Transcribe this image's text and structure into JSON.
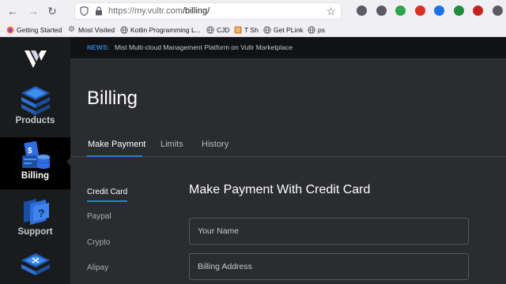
{
  "browser": {
    "url_host": "https://my.vultr.com",
    "url_path": "/billing/",
    "bookmarks": [
      {
        "label": "Getting Started",
        "icon": "firefox-icon"
      },
      {
        "label": "Most Visited",
        "icon": "gear-icon"
      },
      {
        "label": "Kotlin Programming L...",
        "icon": "globe-icon"
      },
      {
        "label": "CJD",
        "icon": "globe-icon"
      },
      {
        "label": "T Sh",
        "icon": "image-icon"
      },
      {
        "label": "Get PLink",
        "icon": "globe-icon"
      },
      {
        "label": "ps",
        "icon": "globe-icon"
      }
    ],
    "extensions": [
      {
        "icon": "pocket-icon",
        "color": "#5b5b66"
      },
      {
        "icon": "account-icon",
        "color": "#5b5b66"
      },
      {
        "icon": "check-icon",
        "color": "#2da44e"
      },
      {
        "icon": "adblock-icon",
        "color": "#d93025"
      },
      {
        "icon": "download-icon",
        "color": "#1a73e8"
      },
      {
        "icon": "image-extension-icon",
        "color": "#1e8e3e"
      },
      {
        "icon": "red-extension-icon",
        "color": "#c5221f"
      },
      {
        "icon": "puzzle-icon",
        "color": "#5b5b66"
      }
    ]
  },
  "sidebar": {
    "items": [
      {
        "label": "Products",
        "icon": "products-stack-icon"
      },
      {
        "label": "Billing",
        "icon": "billing-icon"
      },
      {
        "label": "Support",
        "icon": "support-icon"
      },
      {
        "label": "",
        "icon": "tools-stack-icon"
      }
    ]
  },
  "news": {
    "tag": "NEWS:",
    "text": "Mist Multi-cloud Management Platform on Vultr Marketplace"
  },
  "page": {
    "title": "Billing",
    "tabs": [
      "Make Payment",
      "Limits",
      "History"
    ],
    "payment_methods": [
      "Credit Card",
      "Paypal",
      "Crypto",
      "Alipay"
    ],
    "form_title": "Make Payment With Credit Card",
    "fields": [
      {
        "placeholder": "Your Name"
      },
      {
        "placeholder": "Billing Address"
      }
    ]
  },
  "colors": {
    "accent": "#2f7dd8",
    "sidebar_bg": "#1a1b1d",
    "main_bg": "#2b2c2f"
  }
}
